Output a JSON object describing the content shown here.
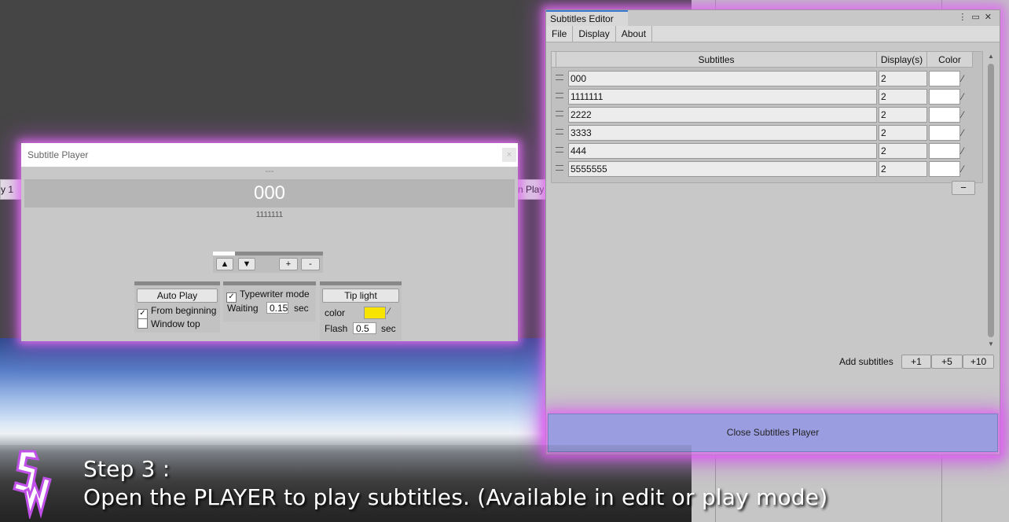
{
  "background": {
    "left_strip_text": "y 1",
    "right_strip_text": "n Play"
  },
  "player": {
    "title": "Subtitle Player",
    "close_glyph": "×",
    "separator": "---",
    "current_line": "000",
    "next_line": "1111111",
    "progress_fraction": 0.2,
    "controls": {
      "up": "▲",
      "down": "▼",
      "plus": "+",
      "minus": "-"
    },
    "auto_play_label": "Auto Play",
    "from_beginning_label": "From beginning",
    "from_beginning_checked": true,
    "window_top_label": "Window top",
    "window_top_checked": false,
    "typewriter_label": "Typewriter mode",
    "typewriter_checked": true,
    "waiting_label": "Waiting",
    "waiting_value": "0.15",
    "waiting_unit": "sec",
    "tip_light_label": "Tip light",
    "color_label": "color",
    "tip_color": "#f7e400",
    "flash_label": "Flash",
    "flash_value": "0.5",
    "flash_unit": "sec"
  },
  "editor": {
    "tab_title": "Subtitles Editor",
    "menu": [
      "File",
      "Display",
      "About"
    ],
    "columns": {
      "subtitles": "Subtitles",
      "display": "Display(s)",
      "color": "Color"
    },
    "rows": [
      {
        "text": "000",
        "display": "2"
      },
      {
        "text": "1111111",
        "display": "2"
      },
      {
        "text": "2222",
        "display": "2"
      },
      {
        "text": "3333",
        "display": "2"
      },
      {
        "text": "444",
        "display": "2"
      },
      {
        "text": "5555555",
        "display": "2"
      }
    ],
    "remove_label": "−",
    "add_subtitles_label": "Add subtitles",
    "add_buttons": [
      "+1",
      "+5",
      "+10"
    ],
    "close_player_label": "Close Subtitles Player"
  },
  "caption": {
    "line1": "Step 3 :",
    "line2": "Open the PLAYER to play subtitles.  (Available in edit or play mode)"
  },
  "colors": {
    "accent_tab": "#3a78d4",
    "glow": "#e06ef0",
    "close_button": "#9a9ee0"
  }
}
